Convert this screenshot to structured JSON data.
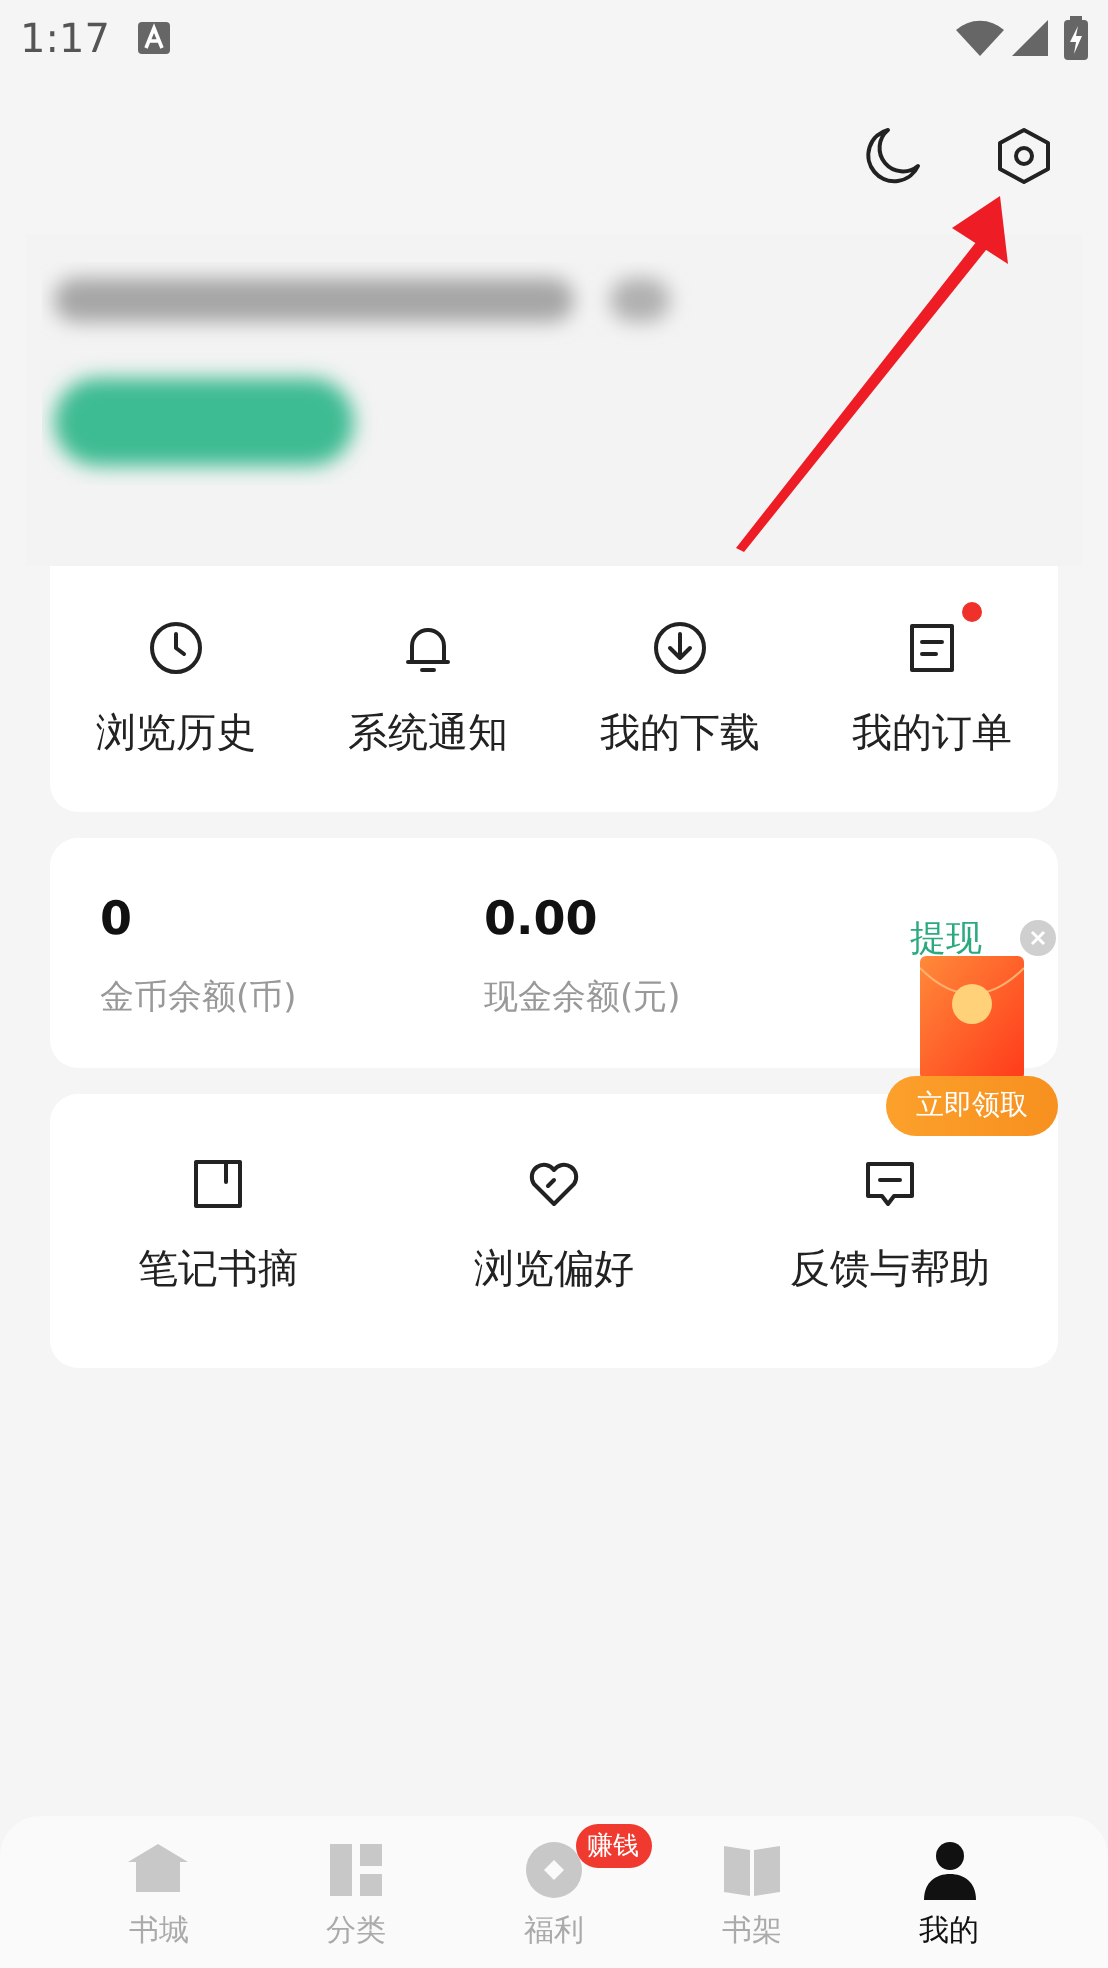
{
  "status_bar": {
    "time": "1:17"
  },
  "quick_actions": [
    {
      "label": "浏览历史",
      "kind": "clock",
      "badge": false
    },
    {
      "label": "系统通知",
      "kind": "bell",
      "badge": false
    },
    {
      "label": "我的下载",
      "kind": "download",
      "badge": false
    },
    {
      "label": "我的订单",
      "kind": "order",
      "badge": true
    }
  ],
  "wallet": {
    "items": [
      {
        "value": "0",
        "label": "金币余额(币)"
      },
      {
        "value": "0.00",
        "label": "现金余额(元)"
      }
    ],
    "withdraw": "提现"
  },
  "tools": [
    {
      "label": "笔记书摘",
      "kind": "note"
    },
    {
      "label": "浏览偏好",
      "kind": "heart"
    },
    {
      "label": "反馈与帮助",
      "kind": "feedback"
    }
  ],
  "promo": {
    "button": "立即领取"
  },
  "bottom_nav": [
    {
      "label": "书城",
      "kind": "home",
      "selected": false
    },
    {
      "label": "分类",
      "kind": "grid",
      "selected": false
    },
    {
      "label": "福利",
      "kind": "coin",
      "selected": false,
      "badge": "赚钱"
    },
    {
      "label": "书架",
      "kind": "book",
      "selected": false
    },
    {
      "label": "我的",
      "kind": "person",
      "selected": true
    }
  ]
}
